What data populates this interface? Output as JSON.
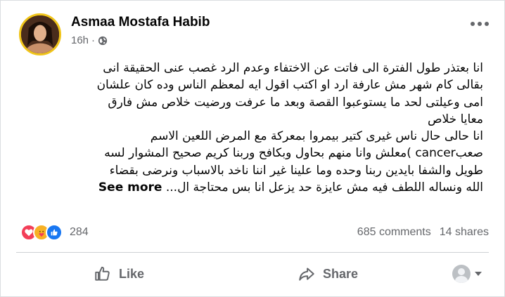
{
  "post": {
    "author": "Asmaa Mostafa Habib",
    "time": "16h",
    "time_separator": "·",
    "lines": [
      "انا بعتذر طول الفترة الى فاتت عن الاختفاء وعدم الرد غصب عنى الحقيقة انى",
      "بقالى كام شهر مش عارفة ارد او اكتب اقول ايه لمعظم الناس وده كان علشان",
      "امى وعيلتى لحد ما يستوعبوا القصة وبعد ما عرفت ورضيت خلاص مش فارق",
      "معايا خلاص",
      "انا حالى حال ناس غيرى كتير  بيمروا بمعركة مع المرض اللعين  الاسم",
      "صعبcancer )معلش وانا منهم بحاول وبكافح وربنا كريم صحيح المشوار لسه",
      "طويل والشفا بايدين ربنا وحده وما علينا غير اننا ناخد بالاسباب ونرضى بقضاء",
      "الله ونساله اللطف فيه مش عايزة حد يزعل انا بس محتاجة ال..."
    ],
    "see_more": "See more"
  },
  "engagement": {
    "reaction_count": "284",
    "comments": "685 comments",
    "shares": "14 shares",
    "reaction_icons": [
      "heart-icon",
      "care-icon",
      "like-icon"
    ],
    "colors": {
      "heart": "#f33e58",
      "care": "#f7b125",
      "like": "#1877f2"
    }
  },
  "actions": {
    "like_label": "Like",
    "share_label": "Share"
  }
}
